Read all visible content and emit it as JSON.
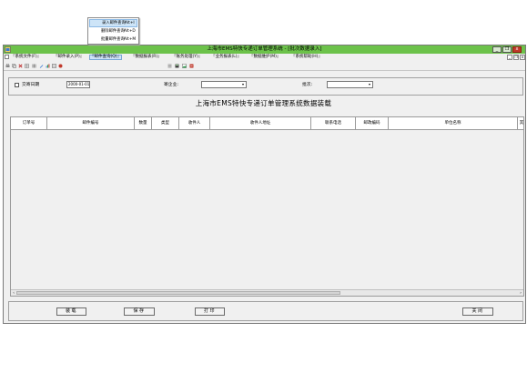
{
  "window": {
    "title": "上海市EMS特快专递订单管理系统 - [批次数据录入]",
    "controls": [
      "_",
      "❐",
      "x"
    ],
    "mdi_controls": [
      "_",
      "❐",
      "x"
    ]
  },
  "menu": [
    "『系统文件(F)』",
    "『邮件录入(P)』",
    "『邮件查询(Q)』",
    "『数据报表(R)』",
    "『账务处理(Y)』",
    "『业务报表(L)』",
    "『数据维护(M)』",
    "『系统帮助(H)』"
  ],
  "dropdown": {
    "items": [
      {
        "label": "录入邮件查询",
        "shortcut": "Alt+I"
      },
      {
        "label": "删除邮件查询",
        "shortcut": "Alt+D"
      },
      {
        "label": "批量邮件查询",
        "shortcut": "Alt+M"
      }
    ]
  },
  "filter": {
    "date_label": "交寄日期",
    "date_value": "2000-01-01",
    "company_label": "寄企业:",
    "company_value": "",
    "batch_label": "批次:",
    "batch_value": ""
  },
  "page_heading": "上海市EMS特快专递订单管理系统数据装载",
  "table": {
    "headers": [
      "订单号",
      "邮件编号",
      "数量",
      "类型",
      "收件人",
      "收件人地址",
      "联系电话",
      "邮政编码",
      "单位名称",
      "其"
    ]
  },
  "buttons": {
    "load": "装载",
    "save": "保存",
    "print": "打印",
    "close": "关闭"
  },
  "colors": {
    "titlebar": "#6cc24a",
    "menu_highlight": "#cfe3f7",
    "window_bg": "#f0f0f0"
  }
}
